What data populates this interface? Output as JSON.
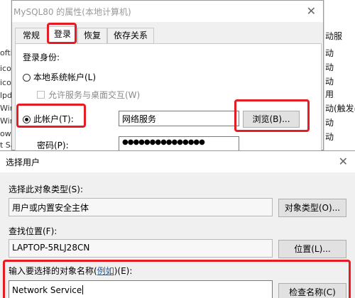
{
  "background": {
    "left_fragments": [
      "ofti",
      "icor",
      "icor",
      "lpd",
      "Wint",
      "Wint",
      "ows",
      "t Sa"
    ],
    "right_fragments": [
      "动服",
      "动",
      "动",
      "动",
      "用",
      "动(触发器",
      "动",
      "动",
      "动",
      "用",
      "动"
    ]
  },
  "props_dialog": {
    "title": "MySQL80 的属性(本地计算机)",
    "close": "✕",
    "tabs": [
      "常规",
      "登录",
      "恢复",
      "依存关系"
    ],
    "login_as_label": "登录身份:",
    "local_system_label": "本地系统帐户(L)",
    "allow_desktop_label": "允许服务与桌面交互(W)",
    "this_account_label": "此帐户(T):",
    "account_value": "网络服务",
    "browse_label": "浏览(B)...",
    "password_label": "密码(P):",
    "password_value": "●●●●●●●●●●●●●●●"
  },
  "select_user_dialog": {
    "title": "选择用户",
    "close": "✕",
    "object_type_label": "选择此对象类型(S):",
    "object_type_value": "用户或内置安全主体",
    "object_type_button": "对象类型(O)...",
    "location_label": "查找位置(F):",
    "location_value": "LAPTOP-5RLJ28CN",
    "location_button": "位置(L)...",
    "enter_names_label_before": "输入要选择的对象名称(",
    "enter_names_link": "例如",
    "enter_names_label_after": ")(E):",
    "names_value": "Network Service",
    "check_names_button": "检查名称(C)"
  }
}
